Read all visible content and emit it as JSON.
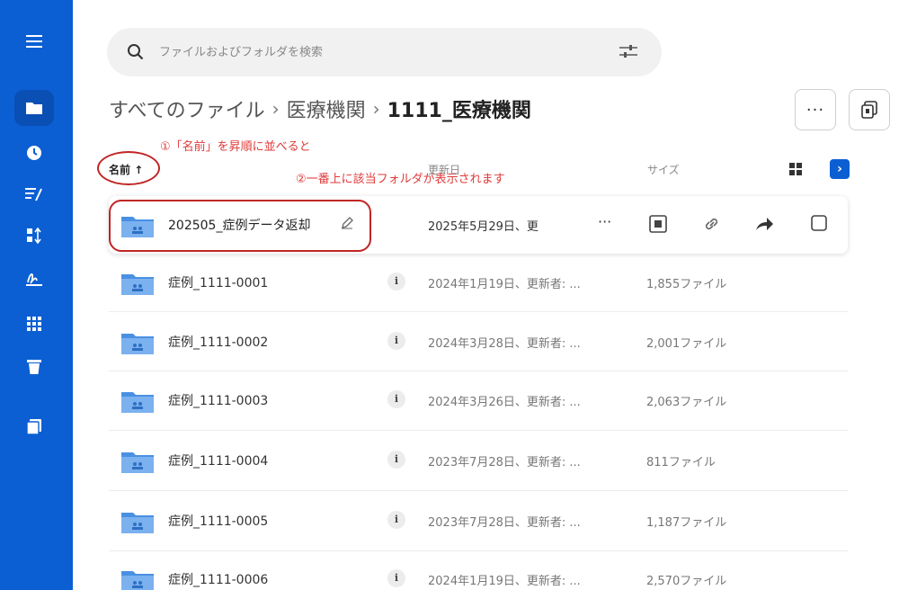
{
  "search": {
    "placeholder": "ファイルおよびフォルダを検索"
  },
  "breadcrumb": {
    "root": "すべてのファイル",
    "parent": "医療機関",
    "current": "1111_医療機関"
  },
  "toolbar": {
    "more_label": "···"
  },
  "annotations": {
    "step1": "①「名前」を昇順に並べると",
    "step2": "②一番上に該当フォルダが表示されます"
  },
  "table": {
    "headers": {
      "name": "名前",
      "sort_arrow": "↑",
      "date": "更新日",
      "size": "サイズ"
    },
    "expand_label": "›",
    "rows": [
      {
        "name": "202505_症例データ返却",
        "date": "2025年5月29日、更",
        "size": ""
      },
      {
        "name": "症例_1111-0001",
        "date": "2024年1月19日、更新者: ...",
        "size": "1,855ファイル"
      },
      {
        "name": "症例_1111-0002",
        "date": "2024年3月28日、更新者: ...",
        "size": "2,001ファイル"
      },
      {
        "name": "症例_1111-0003",
        "date": "2024年3月26日、更新者: ...",
        "size": "2,063ファイル"
      },
      {
        "name": "症例_1111-0004",
        "date": "2023年7月28日、更新者: ...",
        "size": "811ファイル"
      },
      {
        "name": "症例_1111-0005",
        "date": "2023年7月28日、更新者: ...",
        "size": "1,187ファイル"
      },
      {
        "name": "症例_1111-0006",
        "date": "2024年1月19日、更新者: ...",
        "size": "2,570ファイル"
      }
    ],
    "info_label": "i",
    "first_row_more": "···"
  },
  "colors": {
    "sidebar": "#0b5fd3",
    "annotation": "#e03a3a",
    "folder": "#4a90e2"
  }
}
